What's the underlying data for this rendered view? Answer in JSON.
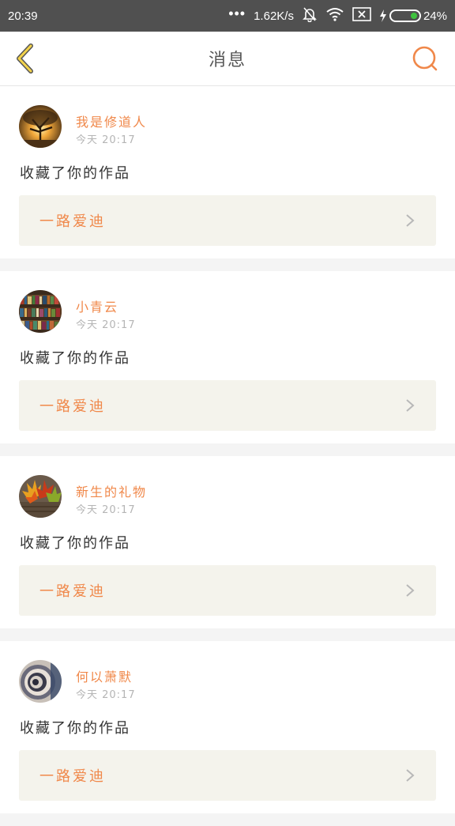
{
  "status_bar": {
    "time": "20:39",
    "dots": "•••",
    "speed": "1.62K/s",
    "battery": "24%",
    "battery_level": 0.24
  },
  "nav": {
    "title": "消息",
    "back_icon": "chevron-left-icon",
    "search_icon": "search-icon",
    "accent_color": "#f0884a"
  },
  "messages": [
    {
      "user": "我是修道人",
      "time": "今天 20:17",
      "action": "收藏了你的作品",
      "work": "一路爱迪",
      "avatar": "tree-sunset-avatar"
    },
    {
      "user": "小青云",
      "time": "今天 20:17",
      "action": "收藏了你的作品",
      "work": "一路爱迪",
      "avatar": "bookshelf-avatar"
    },
    {
      "user": "新生的礼物",
      "time": "今天 20:17",
      "action": "收藏了你的作品",
      "work": "一路爱迪",
      "avatar": "autumn-leaves-avatar"
    },
    {
      "user": "何以萧默",
      "time": "今天 20:17",
      "action": "收藏了你的作品",
      "work": "一路爱迪",
      "avatar": "spiral-avatar"
    }
  ]
}
